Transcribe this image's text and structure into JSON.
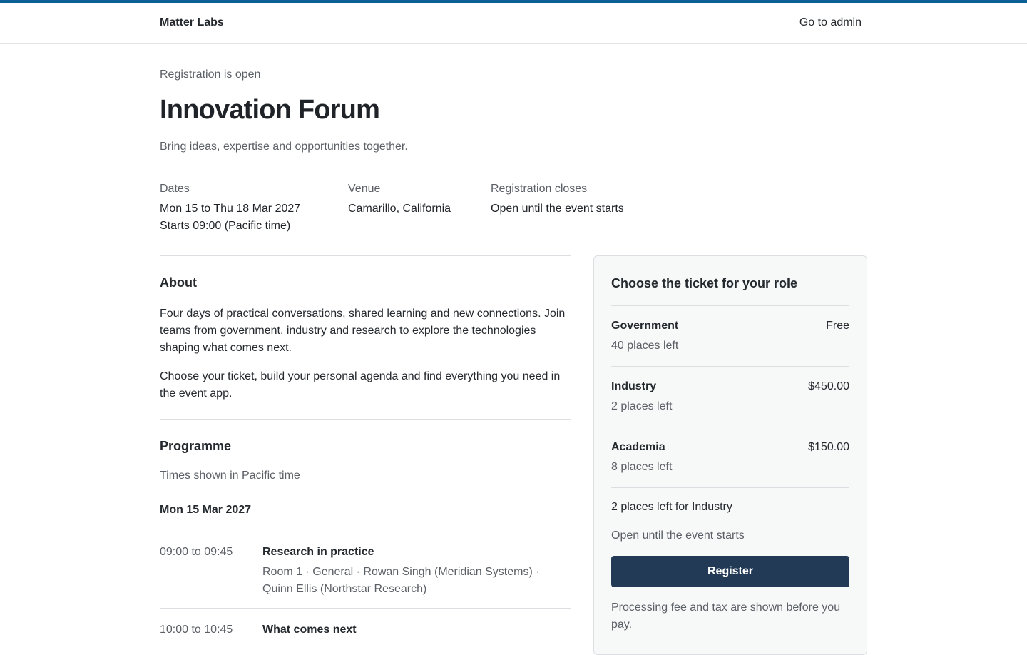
{
  "header": {
    "brand": "Matter Labs",
    "admin_link": "Go to admin",
    "accent_color": "#0b6196"
  },
  "event": {
    "status": "Registration is open",
    "title": "Innovation Forum",
    "tagline": "Bring ideas, expertise and opportunities together."
  },
  "meta": {
    "dates_label": "Dates",
    "dates_value": "Mon 15 to Thu 18 Mar 2027",
    "dates_start": "Starts 09:00 (Pacific time)",
    "venue_label": "Venue",
    "venue_value": "Camarillo, California",
    "closes_label": "Registration closes",
    "closes_value": "Open until the event starts"
  },
  "about": {
    "title": "About",
    "p1": "Four days of practical conversations, shared learning and new connections. Join teams from government, industry and research to explore the technologies shaping what comes next.",
    "p2": "Choose your ticket, build your personal agenda and find everything you need in the event app."
  },
  "programme": {
    "title": "Programme",
    "note": "Times shown in Pacific time",
    "day": "Mon 15 Mar 2027",
    "sessions": [
      {
        "time": "09:00 to 09:45",
        "name": "Research in practice",
        "detail": "Room 1 · General · Rowan Singh (Meridian Systems) · Quinn Ellis (Northstar Research)"
      },
      {
        "time": "10:00 to 10:45",
        "name": "What comes next",
        "detail": ""
      }
    ]
  },
  "tickets": {
    "title": "Choose the ticket for your role",
    "items": [
      {
        "name": "Government",
        "price": "Free",
        "places": "40 places left"
      },
      {
        "name": "Industry",
        "price": "$450.00",
        "places": "2 places left"
      },
      {
        "name": "Academia",
        "price": "$150.00",
        "places": "8 places left"
      }
    ],
    "availability": "2 places left for Industry",
    "closes": "Open until the event starts",
    "register_label": "Register",
    "button_color": "#233a56",
    "fee_note": "Processing fee and tax are shown before you pay."
  }
}
